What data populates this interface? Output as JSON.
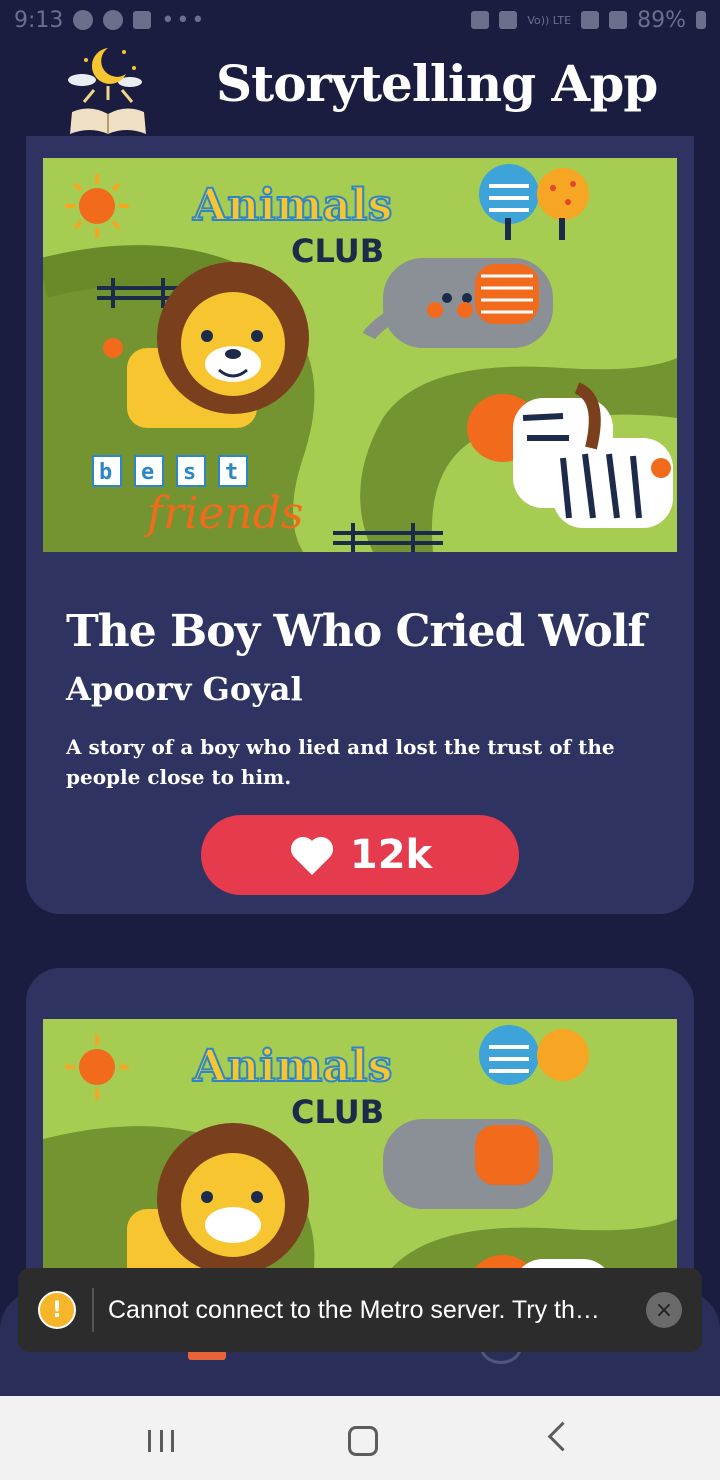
{
  "status_bar": {
    "time": "9:13",
    "dots": "•••",
    "battery": "89%",
    "network": "Vo)) LTE"
  },
  "app": {
    "title": "Storytelling App"
  },
  "stories": [
    {
      "cover": {
        "brand_top": "Animals",
        "brand_bottom": "CLUB",
        "tag_letters": [
          "b",
          "e",
          "s",
          "t"
        ],
        "tag_script": "friends"
      },
      "title": "The Boy Who Cried Wolf",
      "author": "Apoorv Goyal",
      "description": "A story of a boy who lied and lost the trust of the people close to him.",
      "likes": "12k"
    },
    {
      "cover": {
        "brand_top": "Animals",
        "brand_bottom": "CLUB"
      }
    }
  ],
  "toast": {
    "message": "Cannot connect to the Metro server.  Try th…",
    "icon": "!",
    "close": "×"
  },
  "colors": {
    "background": "#1a1d3f",
    "card": "#2f3361",
    "like": "#e63a4d",
    "cover_green": "#a7cc52"
  },
  "icons": [
    "wifi-icon",
    "signal-icon",
    "battery-icon",
    "heart-icon",
    "warning-icon",
    "close-icon",
    "recents-icon",
    "home-icon",
    "back-icon"
  ]
}
